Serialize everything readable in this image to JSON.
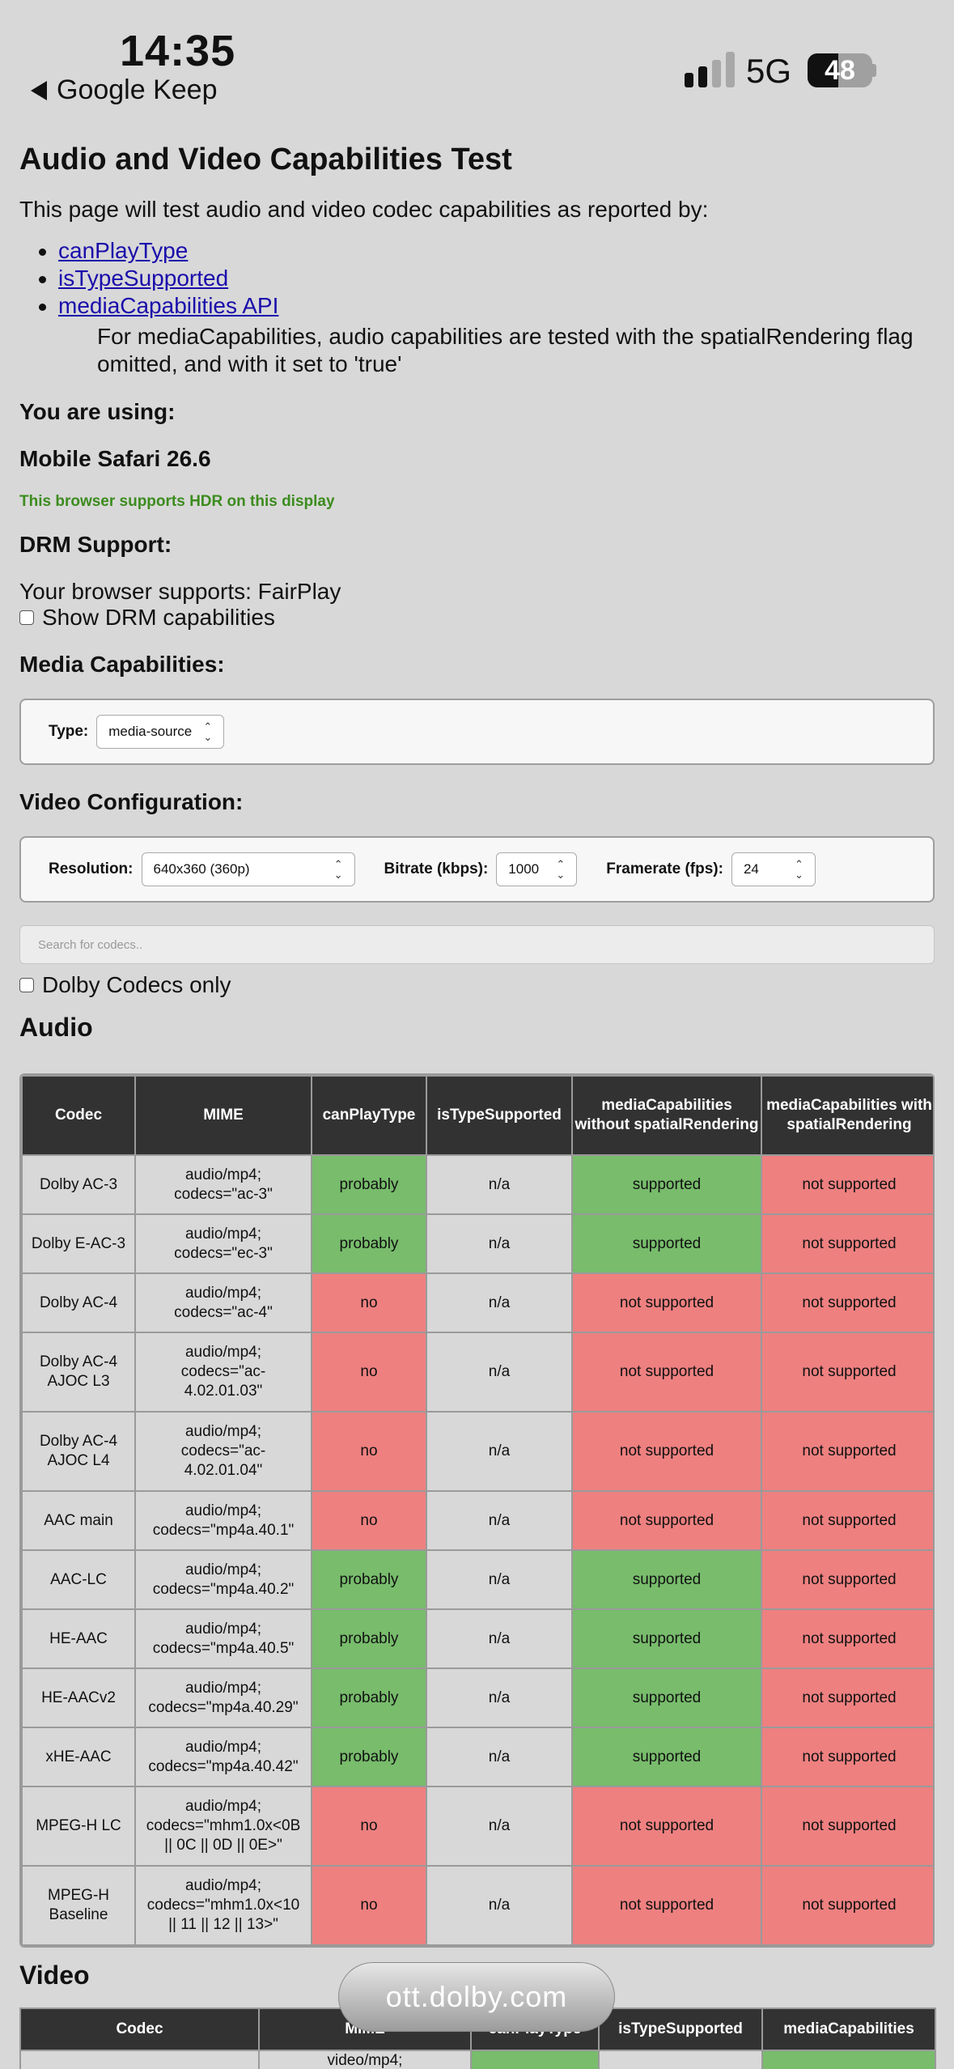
{
  "status_bar": {
    "time": "14:35",
    "back_app": "Google Keep",
    "network": "5G",
    "battery": "48",
    "battery_level": 48
  },
  "page": {
    "title": "Audio and Video Capabilities Test",
    "intro": "This page will test audio and video codec capabilities as reported by:",
    "links": [
      "canPlayType",
      "isTypeSupported",
      "mediaCapabilities API"
    ],
    "note": "For mediaCapabilities, audio capabilities are tested with the spatialRendering flag omitted, and with it set to 'true'",
    "using_label": "You are using:",
    "browser": "Mobile Safari 26.6",
    "hdr": "This browser supports HDR on this display",
    "drm_heading": "DRM Support:",
    "drm_text": "Your browser supports: FairPlay",
    "drm_show": "Show DRM capabilities",
    "media_caps_heading": "Media Capabilities:",
    "type_label": "Type:",
    "type_value": "media-source",
    "video_config_heading": "Video Configuration:",
    "resolution_label": "Resolution:",
    "resolution_value": "640x360 (360p)",
    "bitrate_label": "Bitrate (kbps):",
    "bitrate_value": "1000",
    "framerate_label": "Framerate (fps):",
    "framerate_value": "24",
    "search_placeholder": "Search for codecs..",
    "dolby_only": "Dolby Codecs only",
    "audio_heading": "Audio",
    "video_heading": "Video",
    "url_pill": "ott.dolby.com"
  },
  "audio_table": {
    "headers": [
      "Codec",
      "MIME",
      "canPlayType",
      "isTypeSupported",
      "mediaCapabilities without spatialRendering",
      "mediaCapabilities with spatialRendering"
    ],
    "rows": [
      [
        "Dolby AC-3",
        "audio/mp4; codecs=\"ac-3\"",
        "probably",
        "n/a",
        "supported",
        "not supported"
      ],
      [
        "Dolby E-AC-3",
        "audio/mp4; codecs=\"ec-3\"",
        "probably",
        "n/a",
        "supported",
        "not supported"
      ],
      [
        "Dolby AC-4",
        "audio/mp4; codecs=\"ac-4\"",
        "no",
        "n/a",
        "not supported",
        "not supported"
      ],
      [
        "Dolby AC-4 AJOC L3",
        "audio/mp4; codecs=\"ac-4.02.01.03\"",
        "no",
        "n/a",
        "not supported",
        "not supported"
      ],
      [
        "Dolby AC-4 AJOC L4",
        "audio/mp4; codecs=\"ac-4.02.01.04\"",
        "no",
        "n/a",
        "not supported",
        "not supported"
      ],
      [
        "AAC main",
        "audio/mp4; codecs=\"mp4a.40.1\"",
        "no",
        "n/a",
        "not supported",
        "not supported"
      ],
      [
        "AAC-LC",
        "audio/mp4; codecs=\"mp4a.40.2\"",
        "probably",
        "n/a",
        "supported",
        "not supported"
      ],
      [
        "HE-AAC",
        "audio/mp4; codecs=\"mp4a.40.5\"",
        "probably",
        "n/a",
        "supported",
        "not supported"
      ],
      [
        "HE-AACv2",
        "audio/mp4; codecs=\"mp4a.40.29\"",
        "probably",
        "n/a",
        "supported",
        "not supported"
      ],
      [
        "xHE-AAC",
        "audio/mp4; codecs=\"mp4a.40.42\"",
        "probably",
        "n/a",
        "supported",
        "not supported"
      ],
      [
        "MPEG-H LC",
        "audio/mp4; codecs=\"mhm1.0x<0B || 0C || 0D || 0E>\"",
        "no",
        "n/a",
        "not supported",
        "not supported"
      ],
      [
        "MPEG-H Baseline",
        "audio/mp4; codecs=\"mhm1.0x<10 || 11 || 12 || 13>\"",
        "no",
        "n/a",
        "not supported",
        "not supported"
      ]
    ]
  },
  "video_table": {
    "headers": [
      "Codec",
      "MIME",
      "canPlayType",
      "isTypeSupported",
      "mediaCapabilities"
    ],
    "first_row_mime": "video/mp4;"
  }
}
